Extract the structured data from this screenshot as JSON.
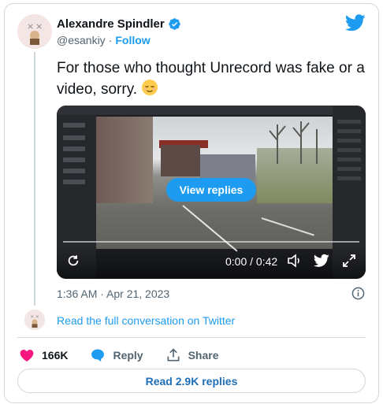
{
  "author": {
    "name": "Alexandre Spindler",
    "handle": "@esankiy",
    "follow_label": "Follow"
  },
  "tweet": {
    "text": "For those who thought Unrecord was fake or a video, sorry."
  },
  "media": {
    "view_replies_label": "View replies",
    "time_display": "0:00 / 0:42"
  },
  "timestamp": "1:36 AM · Apr 21, 2023",
  "read_full_label": "Read the full conversation on Twitter",
  "actions": {
    "likes": "166K",
    "reply_label": "Reply",
    "share_label": "Share"
  },
  "read_replies_label": "Read 2.9K replies",
  "colors": {
    "accent": "#1d9bf0",
    "like": "#f91880"
  },
  "icons": [
    "verified-badge-icon",
    "twitter-logo-icon",
    "relieved-face-emoji",
    "replay-icon",
    "volume-icon",
    "twitter-bird-icon",
    "fullscreen-icon",
    "info-icon",
    "heart-icon",
    "reply-bubble-icon",
    "share-icon"
  ]
}
